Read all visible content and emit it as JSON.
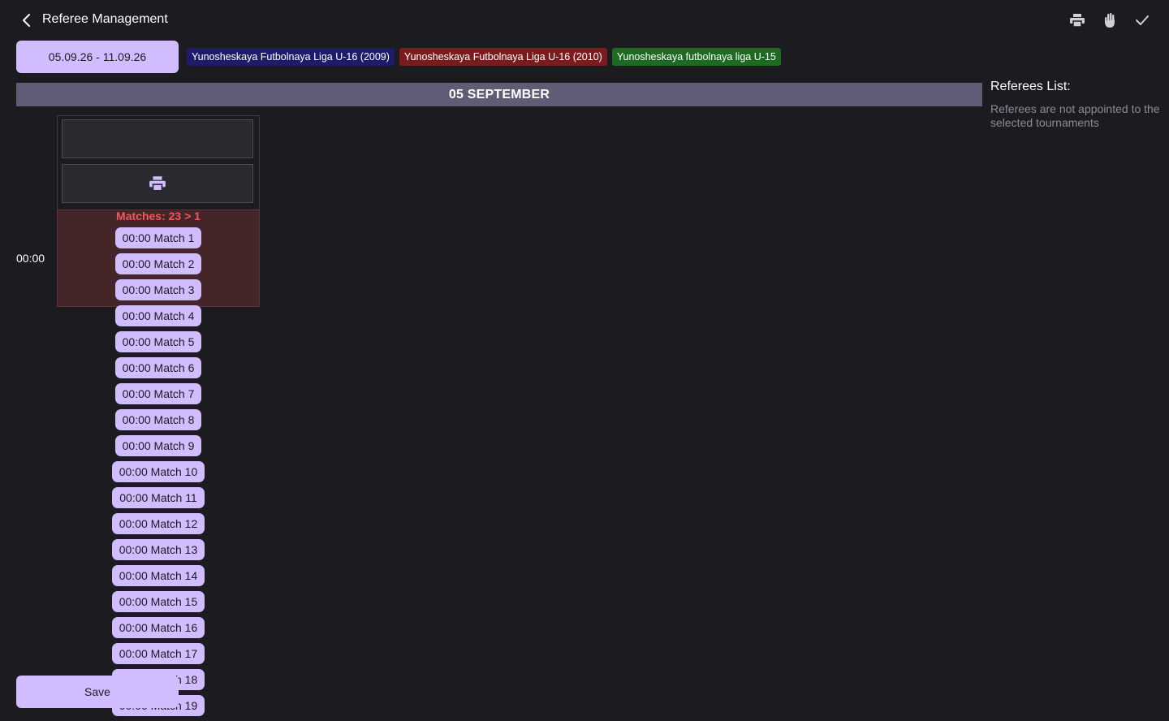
{
  "header": {
    "title": "Referee Management",
    "back_icon": "chevron-left-icon",
    "actions": [
      {
        "name": "print-icon"
      },
      {
        "name": "hand-icon"
      },
      {
        "name": "checkmark-icon"
      }
    ]
  },
  "filters": {
    "date_range": "05.09.26 - 11.09.26",
    "tournaments": [
      {
        "label": "Yunosheskaya Futbolnaya Liga U-16 (2009)",
        "color": "#1e1b6b"
      },
      {
        "label": "Yunosheskaya Futbolnaya Liga U-16 (2010)",
        "color": "#7a1c1e"
      },
      {
        "label": "Yunosheskaya futbolnaya liga U-15",
        "color": "#1d6b22"
      }
    ]
  },
  "schedule": {
    "day_header": "05 SEPTEMBER",
    "time_slot": {
      "time": "00:00",
      "matches_count_label": "Matches: 23 > 1",
      "matches": [
        "00:00 Match 1",
        "00:00 Match 2",
        "00:00 Match 3",
        "00:00 Match 4",
        "00:00 Match 5",
        "00:00 Match 6",
        "00:00 Match 7",
        "00:00 Match 8",
        "00:00 Match 9",
        "00:00 Match 10",
        "00:00 Match 11",
        "00:00 Match 12",
        "00:00 Match 13",
        "00:00 Match 14",
        "00:00 Match 15",
        "00:00 Match 16",
        "00:00 Match 17",
        "00:00 Match 18",
        "00:00 Match 19"
      ]
    }
  },
  "referees": {
    "title": "Referees List:",
    "empty_message": "Referees are not appointed to the selected tournaments"
  },
  "footer": {
    "save_label": "Save"
  },
  "colors": {
    "accent": "#d0bcff",
    "background": "#1c1b20",
    "day_header": "#615c75",
    "warning_text": "#f0585e",
    "warning_bg": "#452628"
  }
}
